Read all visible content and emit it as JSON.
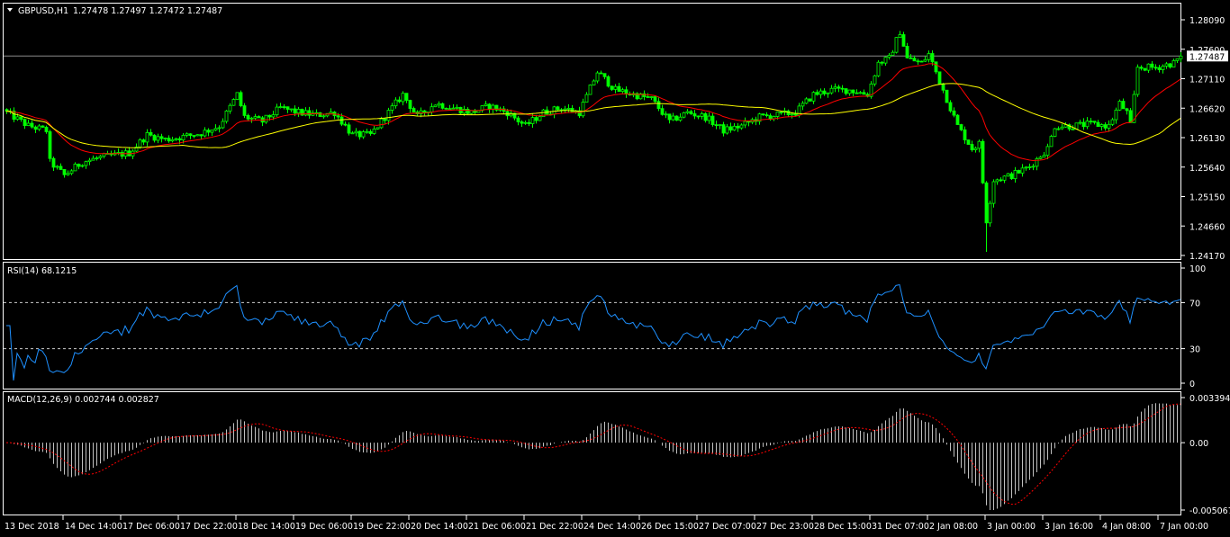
{
  "header": {
    "symbol": "GBPUSD,H1",
    "ohlc": "1.27478 1.27497 1.27472 1.27487",
    "menu_arrow_icon": "triangle-down-icon"
  },
  "colors": {
    "background": "#000000",
    "candle": "#00ff00",
    "ma_fast": "#ff0000",
    "ma_slow": "#ffff00",
    "rsi": "#1e90ff",
    "macd_hist": "#c0c0c0",
    "macd_signal": "#ff0000",
    "grid_text": "#ffffff"
  },
  "chart_data": [
    {
      "type": "candlestick",
      "title": "GBPUSD,H1",
      "current_price": "1.27487",
      "ylim": [
        1.2417,
        1.2809
      ],
      "y_ticks": [
        "1.28090",
        "1.27600",
        "1.27110",
        "1.26620",
        "1.26130",
        "1.25640",
        "1.25150",
        "1.24660",
        "1.24170"
      ],
      "bar_count": 327,
      "close_anchors": [
        [
          0,
          1.26549
        ],
        [
          6,
          1.26325
        ],
        [
          11,
          1.2625
        ],
        [
          12,
          1.25726
        ],
        [
          16,
          1.25502
        ],
        [
          21,
          1.25726
        ],
        [
          26,
          1.25801
        ],
        [
          34,
          1.25876
        ],
        [
          39,
          1.26175
        ],
        [
          44,
          1.261
        ],
        [
          49,
          1.26145
        ],
        [
          54,
          1.26205
        ],
        [
          59,
          1.26325
        ],
        [
          64,
          1.26848
        ],
        [
          66,
          1.26474
        ],
        [
          71,
          1.26399
        ],
        [
          76,
          1.26624
        ],
        [
          81,
          1.26549
        ],
        [
          86,
          1.26504
        ],
        [
          91,
          1.26549
        ],
        [
          96,
          1.26175
        ],
        [
          101,
          1.26175
        ],
        [
          106,
          1.26549
        ],
        [
          110,
          1.26848
        ],
        [
          114,
          1.26474
        ],
        [
          119,
          1.26699
        ],
        [
          124,
          1.26624
        ],
        [
          129,
          1.26549
        ],
        [
          134,
          1.26655
        ],
        [
          139,
          1.26549
        ],
        [
          144,
          1.26325
        ],
        [
          149,
          1.26549
        ],
        [
          154,
          1.26624
        ],
        [
          159,
          1.26549
        ],
        [
          164,
          1.27222
        ],
        [
          169,
          1.26923
        ],
        [
          174,
          1.26848
        ],
        [
          179,
          1.26773
        ],
        [
          184,
          1.26399
        ],
        [
          189,
          1.26549
        ],
        [
          194,
          1.26474
        ],
        [
          199,
          1.2625
        ],
        [
          204,
          1.26325
        ],
        [
          209,
          1.26474
        ],
        [
          214,
          1.26504
        ],
        [
          219,
          1.26549
        ],
        [
          224,
          1.26848
        ],
        [
          229,
          1.26923
        ],
        [
          234,
          1.26923
        ],
        [
          239,
          1.26848
        ],
        [
          242,
          1.27372
        ],
        [
          245,
          1.27447
        ],
        [
          248,
          1.27896
        ],
        [
          250,
          1.27447
        ],
        [
          254,
          1.27372
        ],
        [
          256,
          1.27521
        ],
        [
          260,
          1.26923
        ],
        [
          264,
          1.26325
        ],
        [
          268,
          1.25951
        ],
        [
          270,
          1.26026
        ],
        [
          272,
          1.24754
        ],
        [
          274,
          1.25427
        ],
        [
          279,
          1.25502
        ],
        [
          284,
          1.25651
        ],
        [
          289,
          1.25951
        ],
        [
          291,
          1.26325
        ],
        [
          296,
          1.26325
        ],
        [
          301,
          1.26355
        ],
        [
          306,
          1.26325
        ],
        [
          309,
          1.26699
        ],
        [
          311,
          1.26549
        ],
        [
          312,
          1.26325
        ],
        [
          314,
          1.27297
        ],
        [
          319,
          1.27297
        ],
        [
          324,
          1.27372
        ],
        [
          326,
          1.27487
        ]
      ],
      "spike_low": [
        272,
        1.2423
      ],
      "ma_fast_period": 20,
      "ma_slow_period": 50,
      "x_ticks": [
        "13 Dec 2018",
        "14 Dec 14:00",
        "17 Dec 06:00",
        "17 Dec 22:00",
        "18 Dec 14:00",
        "19 Dec 06:00",
        "19 Dec 22:00",
        "20 Dec 14:00",
        "21 Dec 06:00",
        "21 Dec 22:00",
        "24 Dec 14:00",
        "26 Dec 15:00",
        "27 Dec 07:00",
        "27 Dec 23:00",
        "28 Dec 15:00",
        "31 Dec 07:00",
        "2 Jan 08:00",
        "3 Jan 00:00",
        "3 Jan 16:00",
        "4 Jan 08:00",
        "7 Jan 00:00"
      ]
    },
    {
      "type": "line",
      "title": "RSI(14) 68.1215",
      "ylim": [
        0,
        100
      ],
      "y_ticks": [
        "100",
        "70",
        "30",
        "0"
      ],
      "levels": [
        70,
        30
      ],
      "period": 14
    },
    {
      "type": "bar",
      "title": "MACD(12,26,9) 0.002744 0.002827",
      "ylim": [
        -0.005067,
        0.003394
      ],
      "y_ticks": [
        "0.003394",
        "0.00",
        "-0.005067"
      ],
      "fast": 12,
      "slow": 26,
      "signal": 9
    }
  ]
}
